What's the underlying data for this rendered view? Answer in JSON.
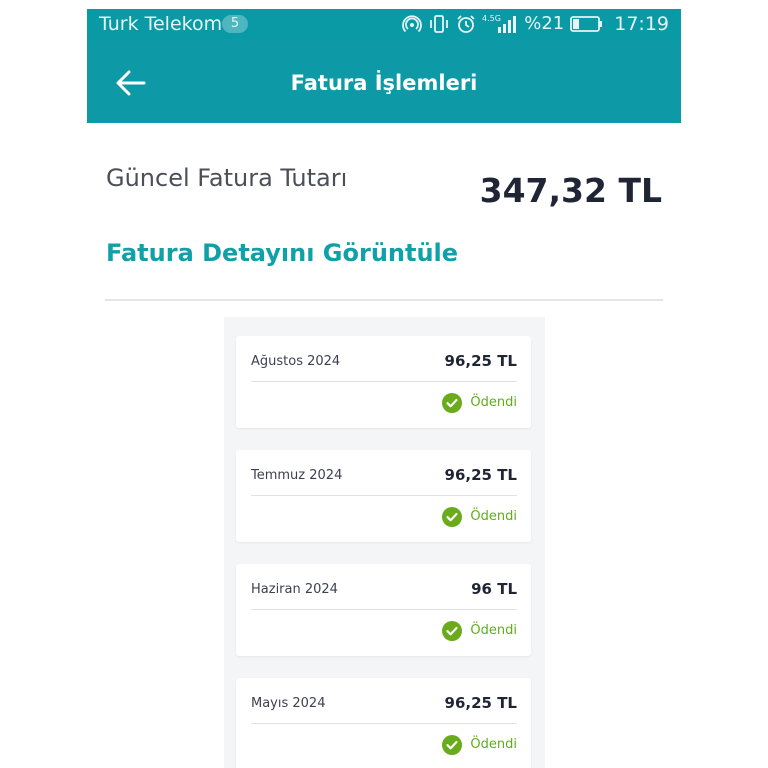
{
  "status_bar": {
    "carrier": "Turk Telekom",
    "sim_badge": "5",
    "network": "4.5G",
    "battery": "%21",
    "time": "17:19",
    "icons": [
      "hotspot-icon",
      "vibrate-icon",
      "alarm-icon",
      "signal-icon",
      "battery-icon"
    ]
  },
  "app_bar": {
    "title": "Fatura İşlemleri",
    "back_icon": "arrow-left-icon"
  },
  "summary": {
    "amount_label": "Güncel Fatura Tutarı",
    "amount_value": "347,32 TL",
    "detail_link": "Fatura Detayını Görüntüle"
  },
  "invoices": [
    {
      "period": "Ağustos 2024",
      "amount": "96,25 TL",
      "status": "Ödendi"
    },
    {
      "period": "Temmuz 2024",
      "amount": "96,25 TL",
      "status": "Ödendi"
    },
    {
      "period": "Haziran 2024",
      "amount": "96 TL",
      "status": "Ödendi"
    },
    {
      "period": "Mayıs 2024",
      "amount": "96,25 TL",
      "status": "Ödendi"
    }
  ],
  "colors": {
    "teal": "#0d9aa6",
    "link": "#11a0a8",
    "paid_green": "#5fae18",
    "check_green": "#6aab1c",
    "dark_text": "#1f2535"
  }
}
